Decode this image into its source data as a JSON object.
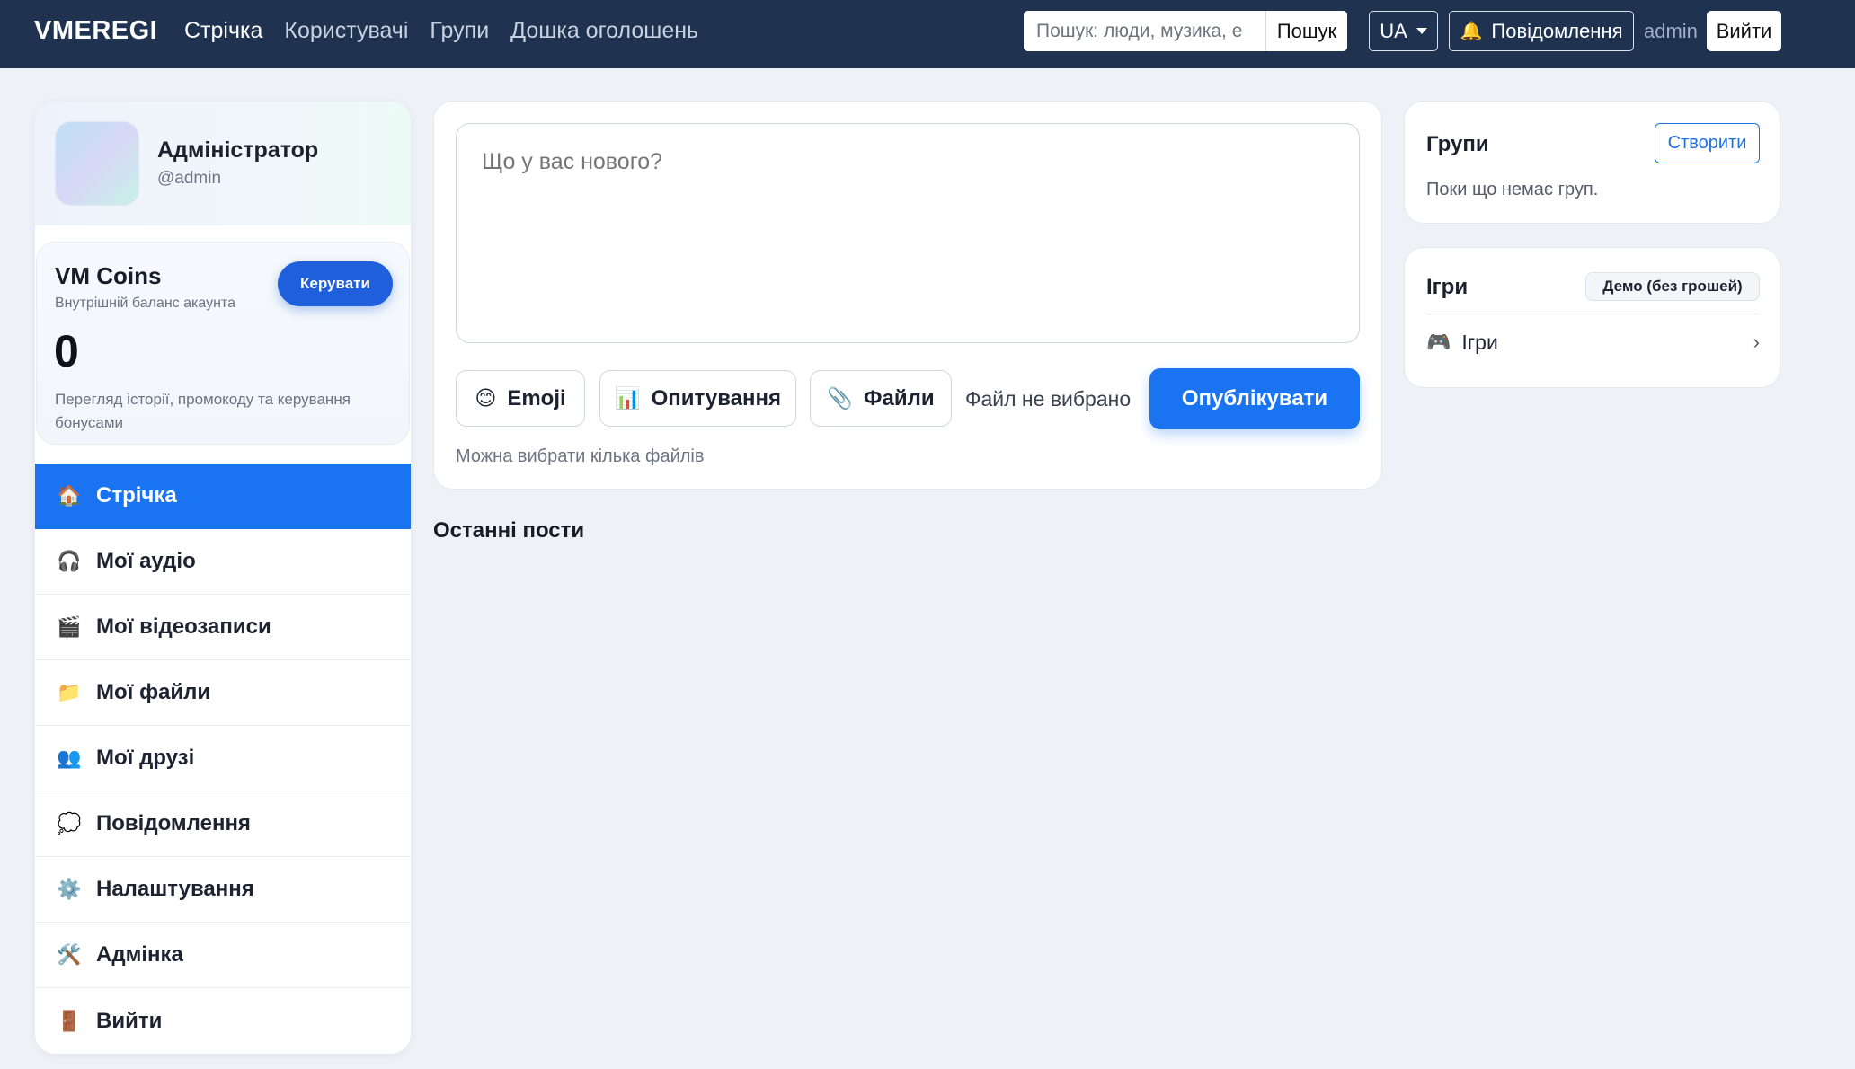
{
  "navbar": {
    "brand": "VMEREGI",
    "links": [
      {
        "label": "Стрічка",
        "active": true
      },
      {
        "label": "Користувачі"
      },
      {
        "label": "Групи"
      },
      {
        "label": "Дошка оголошень"
      }
    ],
    "search_placeholder": "Пошук: люди, музика, е",
    "search_button": "Пошук",
    "language": "UA",
    "notifications_label": "Повідомлення",
    "notifications_icon": "bell-icon",
    "username": "admin",
    "logout_label": "Вийти"
  },
  "profile": {
    "name": "Адміністратор",
    "handle": "@admin"
  },
  "coins": {
    "title": "VM Coins",
    "subtitle": "Внутрішній баланс акаунта",
    "manage_label": "Керувати",
    "balance": "0",
    "description": "Перегляд історії, промокоду та керування бонусами"
  },
  "sidebar": {
    "items": [
      {
        "icon": "🏠",
        "icon_name": "home-icon",
        "label": "Стрічка",
        "active": true
      },
      {
        "icon": "🎧",
        "icon_name": "headphones-icon",
        "label": "Мої аудіо"
      },
      {
        "icon": "🎬",
        "icon_name": "clapper-icon",
        "label": "Мої відеозаписи"
      },
      {
        "icon": "📁",
        "icon_name": "folder-icon",
        "label": "Мої файли"
      },
      {
        "icon": "👥",
        "icon_name": "friends-icon",
        "label": "Мої друзі"
      },
      {
        "icon": "💭",
        "icon_name": "chat-bubble-icon",
        "label": "Повідомлення"
      },
      {
        "icon": "⚙️",
        "icon_name": "gear-icon",
        "label": "Налаштування"
      },
      {
        "icon": "🛠️",
        "icon_name": "tools-icon",
        "label": "Адмінка"
      },
      {
        "icon": "🚪",
        "icon_name": "door-icon",
        "label": "Вийти"
      }
    ]
  },
  "composer": {
    "placeholder": "Що у вас нового?",
    "emoji_button": {
      "icon": "😊",
      "label": "Emoji"
    },
    "poll_button": {
      "icon": "📊",
      "label": "Опитування"
    },
    "files_button": {
      "icon": "📎",
      "label": "Файли"
    },
    "file_status": "Файл не вибрано",
    "publish_label": "Опублікувати",
    "hint": "Можна вибрати кілька файлів"
  },
  "feed": {
    "recent_title": "Останні пости"
  },
  "groups": {
    "title": "Групи",
    "create_label": "Створити",
    "empty_text": "Поки що немає груп."
  },
  "games": {
    "title": "Ігри",
    "badge": "Демо (без грошей)",
    "item_icon": "🎮",
    "item_label": "Ігри",
    "chevron": "›"
  },
  "colors": {
    "navbar_bg": "#1f3350",
    "accent": "#1a73f0",
    "page_bg": "#eef1f6"
  }
}
